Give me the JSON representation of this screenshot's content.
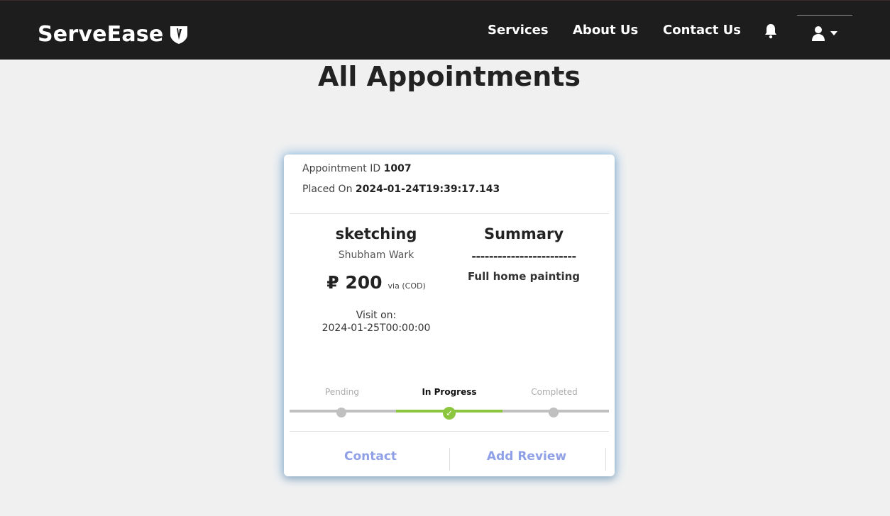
{
  "nav": {
    "brand": "ServeEase",
    "links": [
      "Services",
      "About Us",
      "Contact Us"
    ],
    "icons": {
      "brand_logo": "shield-logo-icon",
      "bell": "bell-icon",
      "user": "user-icon",
      "caret": "caret-down-icon"
    }
  },
  "page": {
    "title": "All Appointments"
  },
  "appointment": {
    "id_label": "Appointment ID",
    "id": "1007",
    "placed_label": "Placed On",
    "placed_on": "2024-01-24T19:39:17.143",
    "service": "sketching",
    "provider": "Shubham Wark",
    "price": "₽ 200",
    "payment": "via (COD)",
    "visit_label": "Visit on:",
    "visit_date": "2024-01-25T00:00:00",
    "summary_title": "Summary",
    "summary_divider": "------------------------",
    "summary_text": "Full home painting",
    "steps": [
      "Pending",
      "In Progress",
      "Completed"
    ],
    "current_step": "In Progress",
    "actions": {
      "contact": "Contact",
      "review": "Add Review"
    },
    "colors": {
      "accent_green": "#8cc63f",
      "action_blue": "#8fa0e6",
      "step_inactive": "#c0c0c0"
    }
  }
}
